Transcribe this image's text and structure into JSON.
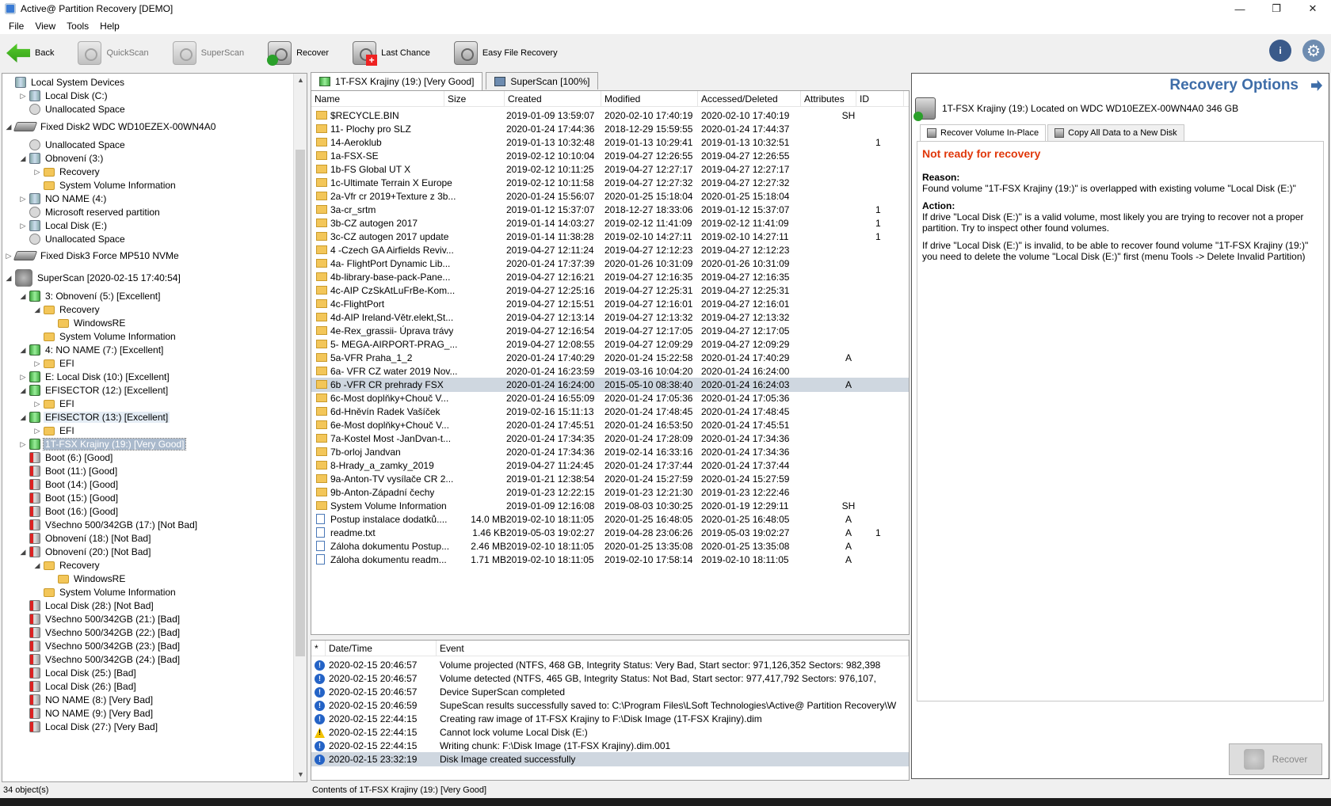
{
  "window": {
    "title": "Active@ Partition Recovery [DEMO]",
    "min": "—",
    "max": "❐",
    "close": "✕"
  },
  "menu": [
    "File",
    "View",
    "Tools",
    "Help"
  ],
  "toolbar": {
    "back": "Back",
    "quickscan": "QuickScan",
    "superscan": "SuperScan",
    "recover": "Recover",
    "last_chance": "Last Chance",
    "easy_file_recovery": "Easy File Recovery",
    "help_icon": "i",
    "gear_icon": "⚙"
  },
  "tree": [
    {
      "label": "Local System Devices",
      "toggle": "",
      "icon": "vol"
    },
    {
      "label": "Local Disk (C:)",
      "toggle": "▷",
      "icon": "vol"
    },
    {
      "label": "Unallocated Space",
      "toggle": "",
      "icon": "un"
    },
    {
      "label": "Fixed Disk2 WDC WD10EZEX-00WN4A0",
      "toggle": "◢",
      "icon": "hdd"
    },
    {
      "label": "Unallocated Space",
      "toggle": "",
      "icon": "un"
    },
    {
      "label": "Obnovení (3:)",
      "toggle": "◢",
      "icon": "vol"
    },
    {
      "label": "Recovery",
      "toggle": "▷",
      "icon": "fold"
    },
    {
      "label": "System Volume Information",
      "toggle": "",
      "icon": "fold"
    },
    {
      "label": "NO NAME (4:)",
      "toggle": "▷",
      "icon": "vol"
    },
    {
      "label": "Microsoft reserved partition",
      "toggle": "",
      "icon": "un"
    },
    {
      "label": "Local Disk (E:)",
      "toggle": "▷",
      "icon": "vol"
    },
    {
      "label": "Unallocated Space",
      "toggle": "",
      "icon": "un"
    },
    {
      "label": "Fixed Disk3 Force MP510      NVMe",
      "toggle": "▷",
      "icon": "hdd"
    },
    {
      "label": "SuperScan [2020-02-15 17:40:54]",
      "toggle": "◢",
      "icon": "ss"
    },
    {
      "label": "3: Obnovení (5:) [Excellent]",
      "toggle": "◢",
      "icon": "volg"
    },
    {
      "label": "Recovery",
      "toggle": "◢",
      "icon": "fold"
    },
    {
      "label": "WindowsRE",
      "toggle": "",
      "icon": "fold"
    },
    {
      "label": "System Volume Information",
      "toggle": "",
      "icon": "fold"
    },
    {
      "label": "4: NO NAME (7:) [Excellent]",
      "toggle": "◢",
      "icon": "volg"
    },
    {
      "label": "EFI",
      "toggle": "▷",
      "icon": "fold"
    },
    {
      "label": "E: Local Disk (10:) [Excellent]",
      "toggle": "▷",
      "icon": "volg"
    },
    {
      "label": "EFISECTOR (12:) [Excellent]",
      "toggle": "◢",
      "icon": "volg"
    },
    {
      "label": "EFI",
      "toggle": "▷",
      "icon": "fold"
    },
    {
      "label": "EFISECTOR (13:) [Excellent]",
      "toggle": "◢",
      "icon": "volg"
    },
    {
      "label": "EFI",
      "toggle": "▷",
      "icon": "fold"
    },
    {
      "label": "1T-FSX Krajiny (19:) [Very Good]",
      "toggle": "▷",
      "icon": "volg"
    },
    {
      "label": "Boot (6:) [Good]",
      "toggle": "",
      "icon": "volr"
    },
    {
      "label": "Boot (11:) [Good]",
      "toggle": "",
      "icon": "volr"
    },
    {
      "label": "Boot (14:) [Good]",
      "toggle": "",
      "icon": "volr"
    },
    {
      "label": "Boot (15:) [Good]",
      "toggle": "",
      "icon": "volr"
    },
    {
      "label": "Boot (16:) [Good]",
      "toggle": "",
      "icon": "volr"
    },
    {
      "label": "Všechno 500/342GB (17:) [Not Bad]",
      "toggle": "",
      "icon": "volr"
    },
    {
      "label": "Obnovení (18:) [Not Bad]",
      "toggle": "",
      "icon": "volr"
    },
    {
      "label": "Obnovení (20:) [Not Bad]",
      "toggle": "◢",
      "icon": "volr"
    },
    {
      "label": "Recovery",
      "toggle": "◢",
      "icon": "fold"
    },
    {
      "label": "WindowsRE",
      "toggle": "",
      "icon": "fold"
    },
    {
      "label": "System Volume Information",
      "toggle": "",
      "icon": "fold"
    },
    {
      "label": "Local Disk (28:) [Not Bad]",
      "toggle": "",
      "icon": "volr"
    },
    {
      "label": "Všechno 500/342GB (21:) [Bad]",
      "toggle": "",
      "icon": "volr"
    },
    {
      "label": "Všechno 500/342GB (22:) [Bad]",
      "toggle": "",
      "icon": "volr"
    },
    {
      "label": "Všechno 500/342GB (23:) [Bad]",
      "toggle": "",
      "icon": "volr"
    },
    {
      "label": "Všechno 500/342GB (24:) [Bad]",
      "toggle": "",
      "icon": "volr"
    },
    {
      "label": "Local Disk (25:) [Bad]",
      "toggle": "",
      "icon": "volr"
    },
    {
      "label": "Local Disk (26:) [Bad]",
      "toggle": "",
      "icon": "volr"
    },
    {
      "label": "NO NAME (8:) [Very Bad]",
      "toggle": "",
      "icon": "volr"
    },
    {
      "label": "NO NAME (9:) [Very Bad]",
      "toggle": "",
      "icon": "volr"
    },
    {
      "label": "Local Disk (27:) [Very Bad]",
      "toggle": "",
      "icon": "volr"
    }
  ],
  "tabs": [
    "1T-FSX Krajiny (19:) [Very Good]",
    "SuperScan [100%]"
  ],
  "filelist": {
    "headers": [
      "Name",
      "Size",
      "Created",
      "Modified",
      "Accessed/Deleted",
      "Attributes",
      "ID"
    ],
    "rows": [
      [
        "$RECYCLE.BIN",
        "",
        "2019-01-09 13:59:07",
        "2020-02-10 17:40:19",
        "2020-02-10 17:40:19",
        "SH",
        "",
        "f"
      ],
      [
        "11- Plochy pro SLZ",
        "",
        "2020-01-24 17:44:36",
        "2018-12-29 15:59:55",
        "2020-01-24 17:44:37",
        "",
        "",
        "f"
      ],
      [
        "14-Aeroklub",
        "",
        "2019-01-13 10:32:48",
        "2019-01-13 10:29:41",
        "2019-01-13 10:32:51",
        "",
        "1",
        "f"
      ],
      [
        "1a-FSX-SE",
        "",
        "2019-02-12 10:10:04",
        "2019-04-27 12:26:55",
        "2019-04-27 12:26:55",
        "",
        "",
        "f"
      ],
      [
        "1b-FS Global UT X",
        "",
        "2019-02-12 10:11:25",
        "2019-04-27 12:27:17",
        "2019-04-27 12:27:17",
        "",
        "",
        "f"
      ],
      [
        "1c-Ultimate Terrain X Europe",
        "",
        "2019-02-12 10:11:58",
        "2019-04-27 12:27:32",
        "2019-04-27 12:27:32",
        "",
        "",
        "f"
      ],
      [
        "2a-Vfr cr 2019+Texture z 3b...",
        "",
        "2020-01-24 15:56:07",
        "2020-01-25 15:18:04",
        "2020-01-25 15:18:04",
        "",
        "",
        "f"
      ],
      [
        "3a-cr_srtm",
        "",
        "2019-01-12 15:37:07",
        "2018-12-27 18:33:06",
        "2019-01-12 15:37:07",
        "",
        "1",
        "f"
      ],
      [
        "3b-CZ autogen 2017",
        "",
        "2019-01-14 14:03:27",
        "2019-02-12 11:41:09",
        "2019-02-12 11:41:09",
        "",
        "1",
        "f"
      ],
      [
        "3c-CZ autogen 2017 update",
        "",
        "2019-01-14 11:38:28",
        "2019-02-10 14:27:11",
        "2019-02-10 14:27:11",
        "",
        "1",
        "f"
      ],
      [
        "4 -Czech GA Airfields Reviv...",
        "",
        "2019-04-27 12:11:24",
        "2019-04-27 12:12:23",
        "2019-04-27 12:12:23",
        "",
        "",
        "f"
      ],
      [
        "4a- FlightPort Dynamic Lib...",
        "",
        "2020-01-24 17:37:39",
        "2020-01-26 10:31:09",
        "2020-01-26 10:31:09",
        "",
        "",
        "f"
      ],
      [
        "4b-library-base-pack-Pane...",
        "",
        "2019-04-27 12:16:21",
        "2019-04-27 12:16:35",
        "2019-04-27 12:16:35",
        "",
        "",
        "f"
      ],
      [
        "4c-AIP CzSkAtLuFrBe-Kom...",
        "",
        "2019-04-27 12:25:16",
        "2019-04-27 12:25:31",
        "2019-04-27 12:25:31",
        "",
        "",
        "f"
      ],
      [
        "4c-FlightPort",
        "",
        "2019-04-27 12:15:51",
        "2019-04-27 12:16:01",
        "2019-04-27 12:16:01",
        "",
        "",
        "f"
      ],
      [
        "4d-AIP Ireland-Větr.elekt,St...",
        "",
        "2019-04-27 12:13:14",
        "2019-04-27 12:13:32",
        "2019-04-27 12:13:32",
        "",
        "",
        "f"
      ],
      [
        "4e-Rex_grassii- Úprava trávy",
        "",
        "2019-04-27 12:16:54",
        "2019-04-27 12:17:05",
        "2019-04-27 12:17:05",
        "",
        "",
        "f"
      ],
      [
        "5- MEGA-AIRPORT-PRAG_...",
        "",
        "2019-04-27 12:08:55",
        "2019-04-27 12:09:29",
        "2019-04-27 12:09:29",
        "",
        "",
        "f"
      ],
      [
        "5a-VFR Praha_1_2",
        "",
        "2020-01-24 17:40:29",
        "2020-01-24 15:22:58",
        "2020-01-24 17:40:29",
        "A",
        "",
        "f"
      ],
      [
        "6a- VFR CZ water 2019 Nov...",
        "",
        "2020-01-24 16:23:59",
        "2019-03-16 10:04:20",
        "2020-01-24 16:24:00",
        "",
        "",
        "f"
      ],
      [
        "6b -VFR CR prehrady FSX",
        "",
        "2020-01-24 16:24:00",
        "2015-05-10 08:38:40",
        "2020-01-24 16:24:03",
        "A",
        "",
        "f"
      ],
      [
        "6c-Most doplňky+Chouč V...",
        "",
        "2020-01-24 16:55:09",
        "2020-01-24 17:05:36",
        "2020-01-24 17:05:36",
        "",
        "",
        "f"
      ],
      [
        "6d-Hněvín Radek Vašíček",
        "",
        "2019-02-16 15:11:13",
        "2020-01-24 17:48:45",
        "2020-01-24 17:48:45",
        "",
        "",
        "f"
      ],
      [
        "6e-Most doplňky+Chouč V...",
        "",
        "2020-01-24 17:45:51",
        "2020-01-24 16:53:50",
        "2020-01-24 17:45:51",
        "",
        "",
        "f"
      ],
      [
        "7a-Kostel Most -JanDvan-t...",
        "",
        "2020-01-24 17:34:35",
        "2020-01-24 17:28:09",
        "2020-01-24 17:34:36",
        "",
        "",
        "f"
      ],
      [
        "7b-orloj Jandvan",
        "",
        "2020-01-24 17:34:36",
        "2019-02-14 16:33:16",
        "2020-01-24 17:34:36",
        "",
        "",
        "f"
      ],
      [
        "8-Hrady_a_zamky_2019",
        "",
        "2019-04-27 11:24:45",
        "2020-01-24 17:37:44",
        "2020-01-24 17:37:44",
        "",
        "",
        "f"
      ],
      [
        "9a-Anton-TV vysílače CR 2...",
        "",
        "2019-01-21 12:38:54",
        "2020-01-24 15:27:59",
        "2020-01-24 15:27:59",
        "",
        "",
        "f"
      ],
      [
        "9b-Anton-Západní čechy",
        "",
        "2019-01-23 12:22:15",
        "2019-01-23 12:21:30",
        "2019-01-23 12:22:46",
        "",
        "",
        "f"
      ],
      [
        "System Volume Information",
        "",
        "2019-01-09 12:16:08",
        "2019-08-03 10:30:25",
        "2020-01-19 12:29:11",
        "SH",
        "",
        "f"
      ],
      [
        "Postup instalace dodatků....",
        "14.0 MB",
        "2019-02-10 18:11:05",
        "2020-01-25 16:48:05",
        "2020-01-25 16:48:05",
        "A",
        "",
        "d"
      ],
      [
        "readme.txt",
        "1.46 KB",
        "2019-05-03 19:02:27",
        "2019-04-28 23:06:26",
        "2019-05-03 19:02:27",
        "A",
        "1",
        "d"
      ],
      [
        "Záloha dokumentu Postup...",
        "2.46 MB",
        "2019-02-10 18:11:05",
        "2020-01-25 13:35:08",
        "2020-01-25 13:35:08",
        "A",
        "",
        "d"
      ],
      [
        "Záloha dokumentu readm...",
        "1.71 MB",
        "2019-02-10 18:11:05",
        "2019-02-10 17:58:14",
        "2019-02-10 18:11:05",
        "A",
        "",
        "d"
      ]
    ]
  },
  "log": {
    "headers": [
      "*",
      "Date/Time",
      "Event"
    ],
    "rows": [
      [
        "i",
        "2020-02-15 20:46:57",
        "Volume projected (NTFS, 468 GB, Integrity Status: Very Bad, Start sector: 971,126,352 Sectors: 982,398"
      ],
      [
        "i",
        "2020-02-15 20:46:57",
        "Volume detected (NTFS, 465 GB, Integrity Status: Not Bad, Start sector: 977,417,792 Sectors: 976,107,"
      ],
      [
        "i",
        "2020-02-15 20:46:57",
        "Device SuperScan completed"
      ],
      [
        "i",
        "2020-02-15 20:46:59",
        "SupeScan results successfully saved to: C:\\Program Files\\LSoft Technologies\\Active@ Partition Recovery\\W"
      ],
      [
        "i",
        "2020-02-15 22:44:15",
        "Creating raw image of 1T-FSX Krajiny to F:\\Disk Image (1T-FSX Krajiny).dim"
      ],
      [
        "w",
        "2020-02-15 22:44:15",
        "Cannot lock volume Local Disk (E:)"
      ],
      [
        "i",
        "2020-02-15 22:44:15",
        "Writing chunk: F:\\Disk Image (1T-FSX Krajiny).dim.001"
      ],
      [
        "i",
        "2020-02-15 23:32:19",
        "Disk Image created successfully"
      ]
    ]
  },
  "recovery": {
    "title": "Recovery Options",
    "volume": "1T-FSX Krajiny (19:) Located on WDC WD10EZEX-00WN4A0 346 GB",
    "tab_inplace": "Recover Volume In-Place",
    "tab_copy": "Copy All Data to a New Disk",
    "status": "Not ready for recovery",
    "reason_label": "Reason:",
    "reason_text": "Found volume \"1T-FSX Krajiny (19:)\" is overlapped with existing volume \"Local Disk (E:)\"",
    "action_label": "Action:",
    "action_text1": "If drive \"Local Disk (E:)\" is a valid volume, most likely you are trying to recover not a proper partition. Try to inspect other found volumes.",
    "action_text2": "If drive \"Local Disk (E:)\" is invalid, to be able to recover found volume \"1T-FSX Krajiny (19:)\" you need to delete the volume \"Local Disk (E:)\" first (menu Tools -> Delete Invalid Partition)",
    "recover_button": "Recover",
    "error_color": "#e0380b",
    "accent_color": "#3e6da8"
  },
  "status": {
    "left": "34 object(s)",
    "mid": "Contents of 1T-FSX Krajiny (19:) [Very Good]"
  }
}
